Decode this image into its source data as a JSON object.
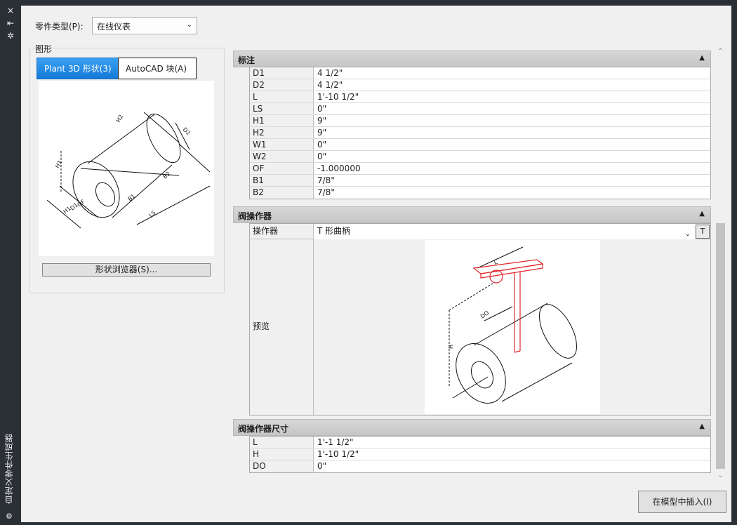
{
  "palette": {
    "title": "自定义零件生成器",
    "close_icon": "×",
    "autohide_icon": "⇤",
    "properties_icon": "✲"
  },
  "part_type": {
    "label": "零件类型(P):",
    "value": "在线仪表"
  },
  "graphics": {
    "group_label": "图形",
    "tabs": [
      {
        "label": "Plant 3D 形状(3)",
        "active": true
      },
      {
        "label": "AutoCAD 块(A)",
        "active": false
      }
    ],
    "shape_browser_button": "形状浏览器(S)..."
  },
  "dimensions": {
    "header": "标注",
    "rows": [
      {
        "k": "D1",
        "v": "4 1/2\""
      },
      {
        "k": "D2",
        "v": "4 1/2\""
      },
      {
        "k": "L",
        "v": "1'-10 1/2\""
      },
      {
        "k": "LS",
        "v": "0\""
      },
      {
        "k": "H1",
        "v": "9\""
      },
      {
        "k": "H2",
        "v": "9\""
      },
      {
        "k": "W1",
        "v": "0\""
      },
      {
        "k": "W2",
        "v": "0\""
      },
      {
        "k": "OF",
        "v": "-1.000000"
      },
      {
        "k": "B1",
        "v": "7/8\""
      },
      {
        "k": "B2",
        "v": "7/8\""
      }
    ]
  },
  "actuator": {
    "header": "阀操作器",
    "operator_label": "操作器",
    "operator_value": "T 形曲柄",
    "preview_label": "预览"
  },
  "actuator_dims": {
    "header": "阀操作器尺寸",
    "rows": [
      {
        "k": "L",
        "v": "1'-1 1/2\""
      },
      {
        "k": "H",
        "v": "1'-10 1/2\""
      },
      {
        "k": "DO",
        "v": "0\""
      }
    ]
  },
  "insert_button": "在模型中插入(I)",
  "colors": {
    "tab_active": "#1479d6",
    "actuator_red": "#e0262b",
    "panel_dark": "#2b2f36"
  }
}
